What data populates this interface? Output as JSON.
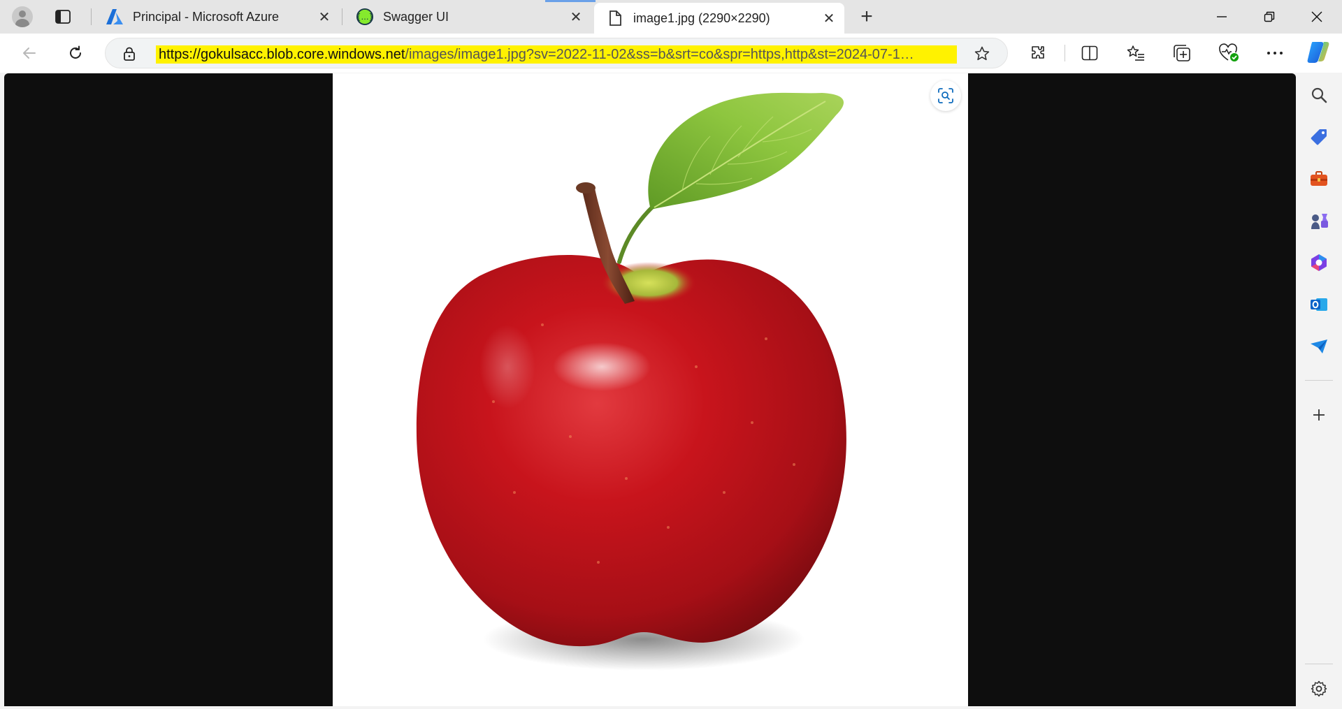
{
  "browser": {
    "tabs": [
      {
        "title": "Principal - Microsoft Azure",
        "icon": "azure-icon"
      },
      {
        "title": "Swagger UI",
        "icon": "swagger-icon"
      },
      {
        "title": "image1.jpg (2290×2290)",
        "icon": "file-icon",
        "active": true
      }
    ],
    "close_glyph": "✕",
    "new_tab_glyph": "+",
    "window_controls": {
      "minimize": "—",
      "restore": "❐",
      "close": "✕"
    },
    "address": {
      "url_host": "https://gokulsacc.blob.core.windows.net",
      "url_rest": "/images/image1.jpg?sv=2022-11-02&ss=b&srt=co&spr=https,http&st=2024-07-1…",
      "highlight_color": "#fff200"
    }
  },
  "image": {
    "file_name": "image1.jpg",
    "subject": "apple-photo",
    "dimensions_label": "2290×2290"
  },
  "sidebar": {
    "items": [
      "search-icon",
      "tag-icon",
      "toolbox-icon",
      "games-icon",
      "m365-icon",
      "outlook-icon",
      "send-icon",
      "add-icon",
      "settings-icon"
    ]
  },
  "colors": {
    "accent": "#0f6cbd",
    "viewer_background": "#0e0e0e",
    "apple_red": "#c8141c",
    "leaf_green": "#7db33a"
  }
}
